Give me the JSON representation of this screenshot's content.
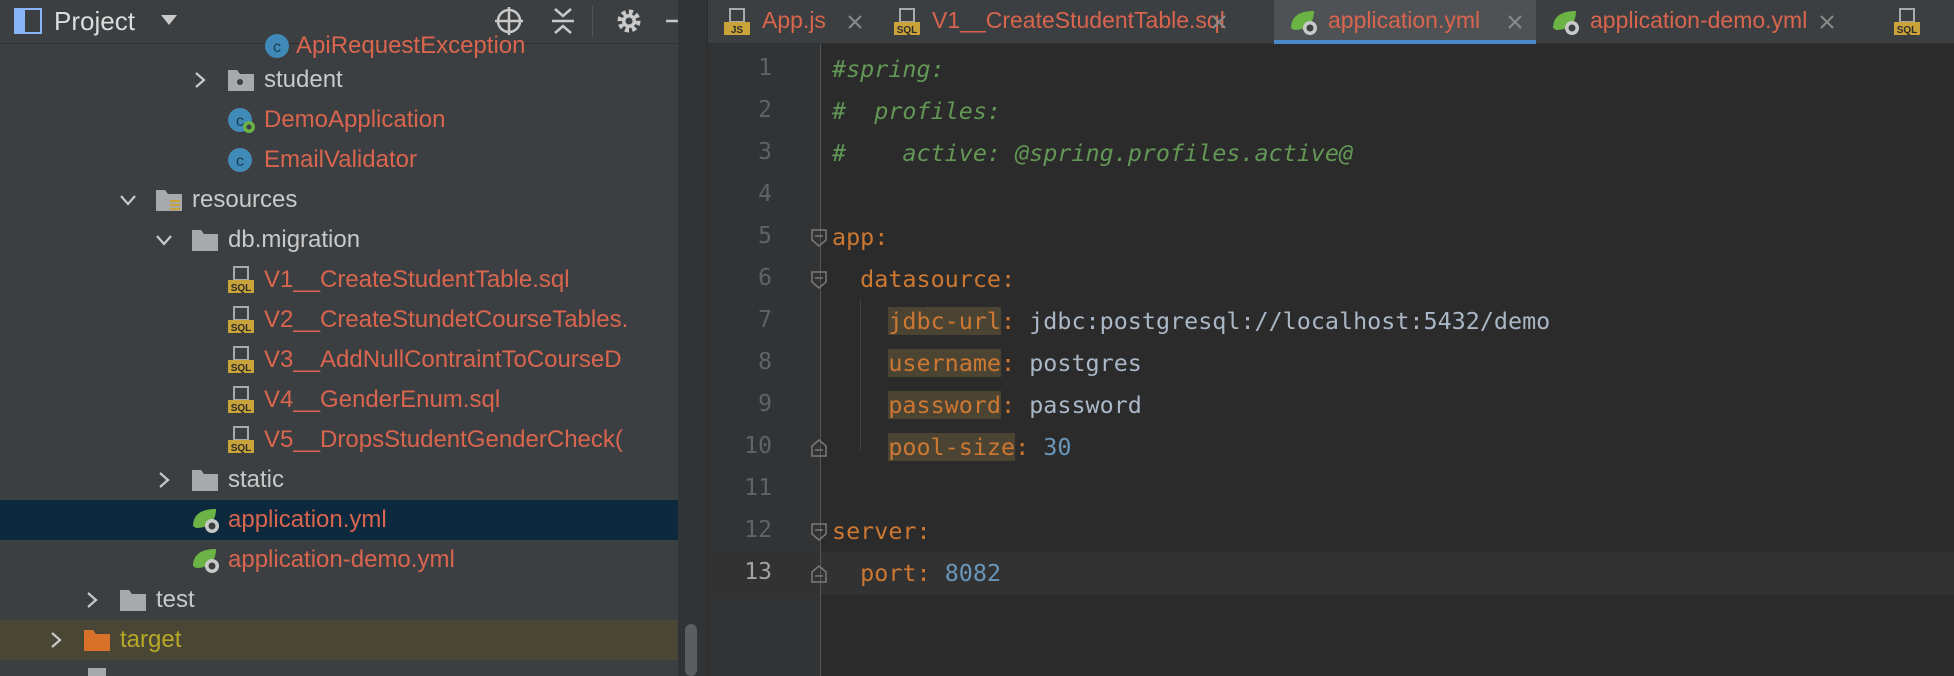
{
  "panel": {
    "title": "Project",
    "tree": [
      {
        "label": "ApiRequestException",
        "color": "red",
        "icon": "class-icon",
        "partial": true
      },
      {
        "label": "student",
        "color": "plain",
        "icon": "package-folder-icon",
        "arrow": "right"
      },
      {
        "label": "DemoApplication",
        "color": "red",
        "icon": "spring-boot-class-icon"
      },
      {
        "label": "EmailValidator",
        "color": "red",
        "icon": "class-icon"
      },
      {
        "label": "resources",
        "color": "plain",
        "icon": "resources-folder-icon",
        "arrow": "down"
      },
      {
        "label": "db.migration",
        "color": "plain",
        "icon": "folder-icon",
        "arrow": "down"
      },
      {
        "label": "V1__CreateStudentTable.sql",
        "color": "red",
        "icon": "sql-file-icon"
      },
      {
        "label": "V2__CreateStundetCourseTables.",
        "color": "red",
        "icon": "sql-file-icon"
      },
      {
        "label": "V3__AddNullContraintToCourseD",
        "color": "red",
        "icon": "sql-file-icon"
      },
      {
        "label": "V4__GenderEnum.sql",
        "color": "red",
        "icon": "sql-file-icon"
      },
      {
        "label": "V5__DropsStudentGenderCheck(",
        "color": "red",
        "icon": "sql-file-icon"
      },
      {
        "label": "static",
        "color": "plain",
        "icon": "folder-icon",
        "arrow": "right"
      },
      {
        "label": "application.yml",
        "color": "red",
        "icon": "spring-yml-icon",
        "selected": true
      },
      {
        "label": "application-demo.yml",
        "color": "red",
        "icon": "spring-yml-icon"
      },
      {
        "label": "test",
        "color": "plain",
        "icon": "folder-icon",
        "arrow": "right"
      },
      {
        "label": "target",
        "color": "olive",
        "icon": "excluded-folder-icon",
        "arrow": "right",
        "highlight": true
      }
    ]
  },
  "tabs": [
    {
      "label": "App.js",
      "icon": "js-file-icon"
    },
    {
      "label": "V1__CreateStudentTable.sql",
      "icon": "sql-file-icon"
    },
    {
      "label": "application.yml",
      "icon": "spring-yml-icon",
      "active": true
    },
    {
      "label": "application-demo.yml",
      "icon": "spring-yml-icon"
    },
    {
      "label": "",
      "icon": "sql-file-icon"
    }
  ],
  "editor": {
    "current_line": 13,
    "line_numbers": [
      "1",
      "2",
      "3",
      "4",
      "5",
      "6",
      "7",
      "8",
      "9",
      "10",
      "11",
      "12",
      "13"
    ],
    "lines": {
      "l1": "#spring:",
      "l2": "#  profiles:",
      "l3": "#    active: @spring.profiles.active@",
      "l5_key": "app",
      "l6_key": "datasource",
      "l7_key": "jdbc-url",
      "l7_val": "jdbc:postgresql://localhost:5432/demo",
      "l8_key": "username",
      "l8_val": "postgres",
      "l9_key": "password",
      "l9_val": "password",
      "l10_key": "pool-size",
      "l10_val": "30",
      "l12_key": "server",
      "l13_key": "port",
      "l13_val": "8082"
    }
  },
  "colors": {
    "accent": "#4a88c7",
    "modified_file": "#d9654e",
    "excluded": "#b7a825",
    "comment": "#629755",
    "yaml_key": "#cc7832",
    "number": "#6897bb",
    "selection": "#0d293e"
  }
}
